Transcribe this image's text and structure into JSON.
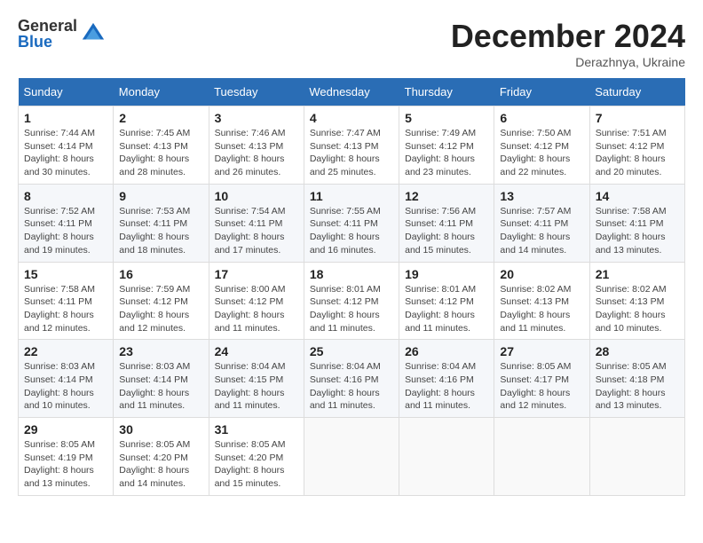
{
  "logo": {
    "general": "General",
    "blue": "Blue"
  },
  "header": {
    "title": "December 2024",
    "subtitle": "Derazhnya, Ukraine"
  },
  "days_of_week": [
    "Sunday",
    "Monday",
    "Tuesday",
    "Wednesday",
    "Thursday",
    "Friday",
    "Saturday"
  ],
  "weeks": [
    [
      {
        "day": "1",
        "sunrise": "7:44 AM",
        "sunset": "4:14 PM",
        "daylight": "8 hours and 30 minutes."
      },
      {
        "day": "2",
        "sunrise": "7:45 AM",
        "sunset": "4:13 PM",
        "daylight": "8 hours and 28 minutes."
      },
      {
        "day": "3",
        "sunrise": "7:46 AM",
        "sunset": "4:13 PM",
        "daylight": "8 hours and 26 minutes."
      },
      {
        "day": "4",
        "sunrise": "7:47 AM",
        "sunset": "4:13 PM",
        "daylight": "8 hours and 25 minutes."
      },
      {
        "day": "5",
        "sunrise": "7:49 AM",
        "sunset": "4:12 PM",
        "daylight": "8 hours and 23 minutes."
      },
      {
        "day": "6",
        "sunrise": "7:50 AM",
        "sunset": "4:12 PM",
        "daylight": "8 hours and 22 minutes."
      },
      {
        "day": "7",
        "sunrise": "7:51 AM",
        "sunset": "4:12 PM",
        "daylight": "8 hours and 20 minutes."
      }
    ],
    [
      {
        "day": "8",
        "sunrise": "7:52 AM",
        "sunset": "4:11 PM",
        "daylight": "8 hours and 19 minutes."
      },
      {
        "day": "9",
        "sunrise": "7:53 AM",
        "sunset": "4:11 PM",
        "daylight": "8 hours and 18 minutes."
      },
      {
        "day": "10",
        "sunrise": "7:54 AM",
        "sunset": "4:11 PM",
        "daylight": "8 hours and 17 minutes."
      },
      {
        "day": "11",
        "sunrise": "7:55 AM",
        "sunset": "4:11 PM",
        "daylight": "8 hours and 16 minutes."
      },
      {
        "day": "12",
        "sunrise": "7:56 AM",
        "sunset": "4:11 PM",
        "daylight": "8 hours and 15 minutes."
      },
      {
        "day": "13",
        "sunrise": "7:57 AM",
        "sunset": "4:11 PM",
        "daylight": "8 hours and 14 minutes."
      },
      {
        "day": "14",
        "sunrise": "7:58 AM",
        "sunset": "4:11 PM",
        "daylight": "8 hours and 13 minutes."
      }
    ],
    [
      {
        "day": "15",
        "sunrise": "7:58 AM",
        "sunset": "4:11 PM",
        "daylight": "8 hours and 12 minutes."
      },
      {
        "day": "16",
        "sunrise": "7:59 AM",
        "sunset": "4:12 PM",
        "daylight": "8 hours and 12 minutes."
      },
      {
        "day": "17",
        "sunrise": "8:00 AM",
        "sunset": "4:12 PM",
        "daylight": "8 hours and 11 minutes."
      },
      {
        "day": "18",
        "sunrise": "8:01 AM",
        "sunset": "4:12 PM",
        "daylight": "8 hours and 11 minutes."
      },
      {
        "day": "19",
        "sunrise": "8:01 AM",
        "sunset": "4:12 PM",
        "daylight": "8 hours and 11 minutes."
      },
      {
        "day": "20",
        "sunrise": "8:02 AM",
        "sunset": "4:13 PM",
        "daylight": "8 hours and 11 minutes."
      },
      {
        "day": "21",
        "sunrise": "8:02 AM",
        "sunset": "4:13 PM",
        "daylight": "8 hours and 10 minutes."
      }
    ],
    [
      {
        "day": "22",
        "sunrise": "8:03 AM",
        "sunset": "4:14 PM",
        "daylight": "8 hours and 10 minutes."
      },
      {
        "day": "23",
        "sunrise": "8:03 AM",
        "sunset": "4:14 PM",
        "daylight": "8 hours and 11 minutes."
      },
      {
        "day": "24",
        "sunrise": "8:04 AM",
        "sunset": "4:15 PM",
        "daylight": "8 hours and 11 minutes."
      },
      {
        "day": "25",
        "sunrise": "8:04 AM",
        "sunset": "4:16 PM",
        "daylight": "8 hours and 11 minutes."
      },
      {
        "day": "26",
        "sunrise": "8:04 AM",
        "sunset": "4:16 PM",
        "daylight": "8 hours and 11 minutes."
      },
      {
        "day": "27",
        "sunrise": "8:05 AM",
        "sunset": "4:17 PM",
        "daylight": "8 hours and 12 minutes."
      },
      {
        "day": "28",
        "sunrise": "8:05 AM",
        "sunset": "4:18 PM",
        "daylight": "8 hours and 13 minutes."
      }
    ],
    [
      {
        "day": "29",
        "sunrise": "8:05 AM",
        "sunset": "4:19 PM",
        "daylight": "8 hours and 13 minutes."
      },
      {
        "day": "30",
        "sunrise": "8:05 AM",
        "sunset": "4:20 PM",
        "daylight": "8 hours and 14 minutes."
      },
      {
        "day": "31",
        "sunrise": "8:05 AM",
        "sunset": "4:20 PM",
        "daylight": "8 hours and 15 minutes."
      },
      null,
      null,
      null,
      null
    ]
  ]
}
